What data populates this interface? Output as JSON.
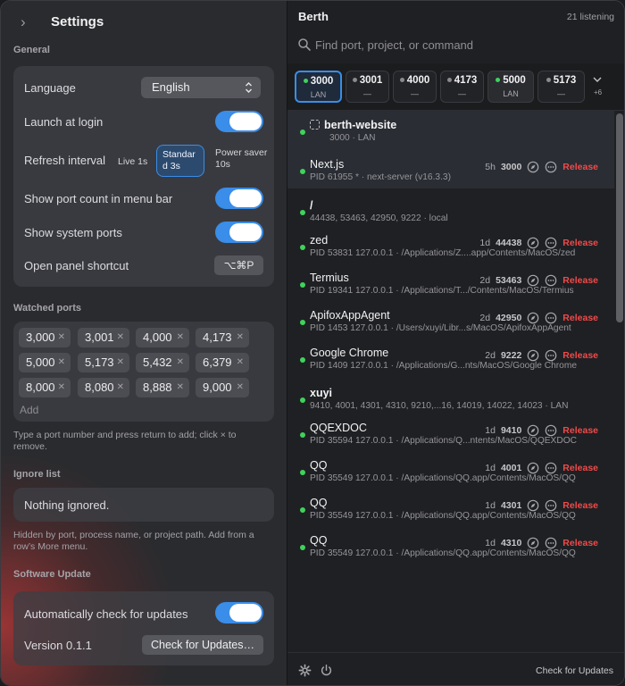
{
  "settings": {
    "title": "Settings",
    "general": {
      "label": "General",
      "language_label": "Language",
      "language_value": "English",
      "launch_label": "Launch at login",
      "refresh_label": "Refresh interval",
      "refresh_options": [
        "Live 1s",
        "Standard 3s",
        "Power saver 10s"
      ],
      "refresh_selected": "Standard 3s",
      "show_port_count_label": "Show port count in menu bar",
      "show_system_ports_label": "Show system ports",
      "shortcut_label": "Open panel shortcut",
      "shortcut_value": "⌥⌘P",
      "toggles": {
        "launch_at_login": true,
        "show_port_count": true,
        "show_system_ports": true
      }
    },
    "watched": {
      "label": "Watched ports",
      "ports": [
        "3,000",
        "3,001",
        "4,000",
        "4,173",
        "5,000",
        "5,173",
        "5,432",
        "6,379",
        "8,000",
        "8,080",
        "8,888",
        "9,000"
      ],
      "add_placeholder": "Add",
      "helper": "Type a port number and press return to add; click × to remove."
    },
    "ignore": {
      "label": "Ignore list",
      "empty": "Nothing ignored.",
      "helper": "Hidden by port, process name, or project path. Add from a row’s More menu."
    },
    "update": {
      "label": "Software Update",
      "auto_label": "Automatically check for updates",
      "auto_enabled": true,
      "version": "Version 0.1.1",
      "check_button": "Check for Updates…"
    }
  },
  "berth": {
    "title": "Berth",
    "listening": "21 listening",
    "search_placeholder": "Find port, project, or command",
    "tabs": [
      {
        "port": "3000",
        "sub": "LAN",
        "active": true,
        "selected": true
      },
      {
        "port": "3001",
        "sub": "—",
        "active": false
      },
      {
        "port": "4000",
        "sub": "—",
        "active": false
      },
      {
        "port": "4173",
        "sub": "—",
        "active": false
      },
      {
        "port": "5000",
        "sub": "LAN",
        "active": true
      },
      {
        "port": "5173",
        "sub": "—",
        "active": false
      }
    ],
    "more_tabs": "+6",
    "items": [
      {
        "name": "berth-website",
        "detail": "3000 · LAN",
        "project": true
      },
      {
        "name": "Next.js",
        "detail": "PID 61955  *  · next-server (v16.3.3)",
        "age": "5h",
        "port": "3000",
        "release": "Release"
      },
      {
        "name": "/",
        "detail": "44438, 53463, 42950, 9222 · local",
        "group": true
      },
      {
        "name": "zed",
        "detail": "PID 53831  127.0.0.1 · /Applications/Z....app/Contents/MacOS/zed",
        "age": "1d",
        "port": "44438",
        "release": "Release"
      },
      {
        "name": "Termius",
        "detail": "PID 19341  127.0.0.1 · /Applications/T.../Contents/MacOS/Termius",
        "age": "2d",
        "port": "53463",
        "release": "Release"
      },
      {
        "name": "ApifoxAppAgent",
        "detail": "PID 1453  127.0.0.1 · /Users/xuyi/Libr...s/MacOS/ApifoxAppAgent",
        "age": "2d",
        "port": "42950",
        "release": "Release"
      },
      {
        "name": "Google Chrome",
        "detail": "PID 1409  127.0.0.1 · /Applications/G...nts/MacOS/Google Chrome",
        "age": "2d",
        "port": "9222",
        "release": "Release"
      },
      {
        "name": "xuyi",
        "detail": "9410, 4001, 4301, 4310, 9210,...16, 14019, 14022, 14023 · LAN",
        "group": true
      },
      {
        "name": "QQEXDOC",
        "detail": "PID 35594  127.0.0.1 · /Applications/Q...ntents/MacOS/QQEXDOC",
        "age": "1d",
        "port": "9410",
        "release": "Release"
      },
      {
        "name": "QQ",
        "detail": "PID 35549  127.0.0.1 · /Applications/QQ.app/Contents/MacOS/QQ",
        "age": "1d",
        "port": "4001",
        "release": "Release"
      },
      {
        "name": "QQ",
        "detail": "PID 35549  127.0.0.1 · /Applications/QQ.app/Contents/MacOS/QQ",
        "age": "1d",
        "port": "4301",
        "release": "Release"
      },
      {
        "name": "QQ",
        "detail": "PID 35549  127.0.0.1 · /Applications/QQ.app/Contents/MacOS/QQ",
        "age": "1d",
        "port": "4310",
        "release": "Release"
      }
    ],
    "footer_check": "Check for Updates"
  },
  "colors": {
    "accent": "#3a8de8",
    "active_dot": "#3fd35c",
    "release": "#f04a4a"
  }
}
